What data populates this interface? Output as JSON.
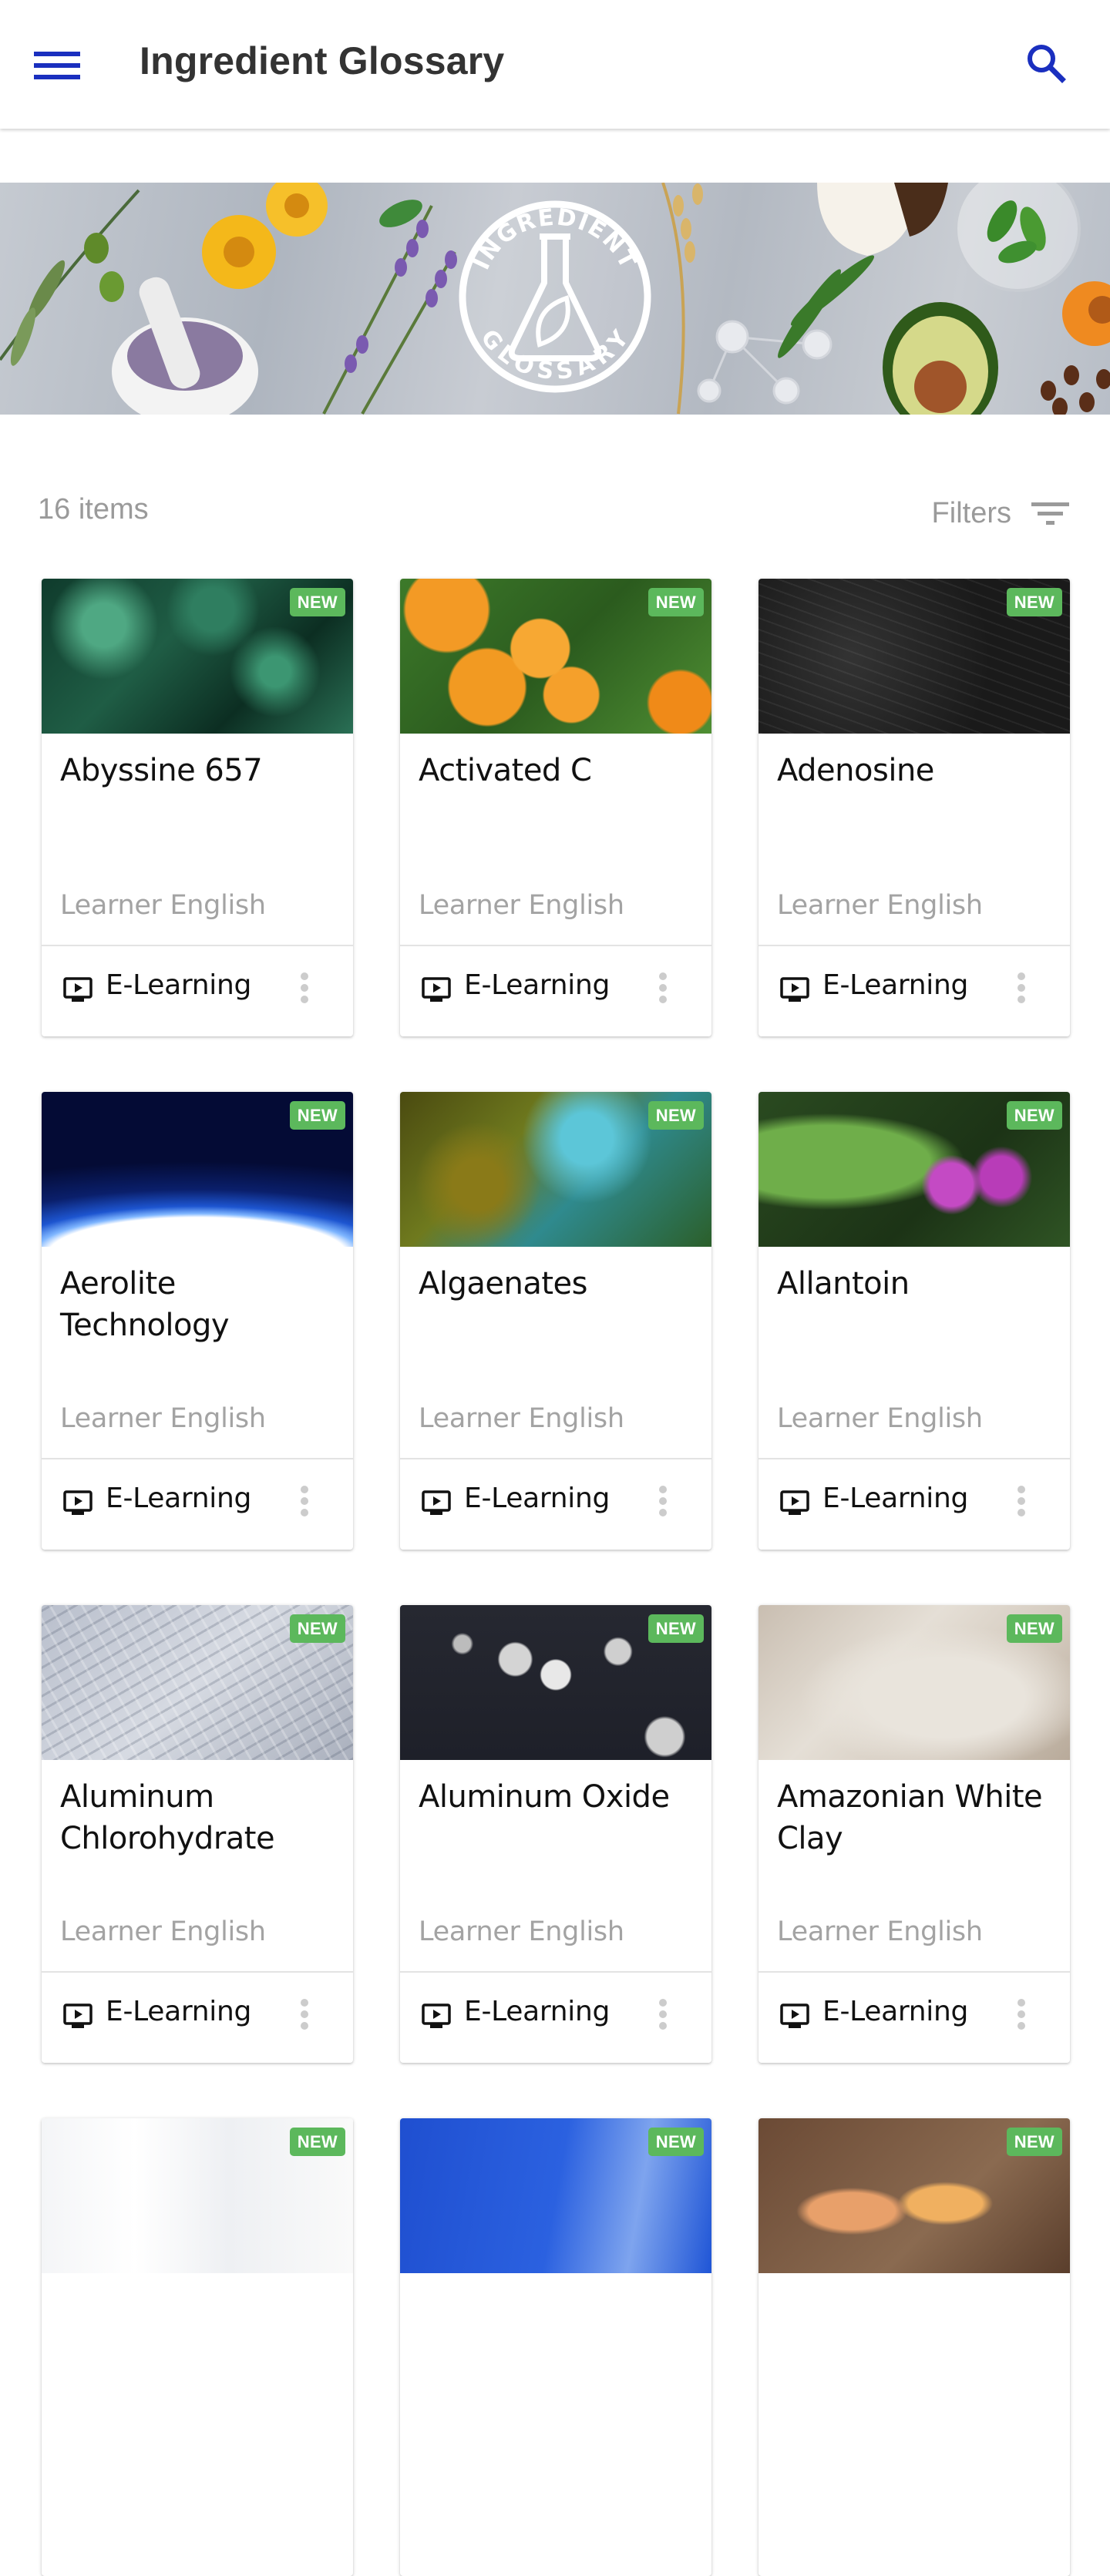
{
  "header": {
    "title": "Ingredient Glossary",
    "menu_icon": "hamburger-menu-icon",
    "search_icon": "search-icon",
    "accent_color": "#1a2fbf"
  },
  "banner": {
    "emblem_top_text": "INGREDIENT",
    "emblem_bottom_text": "GLOSSARY",
    "emblem_icon": "flask-leaf-icon"
  },
  "toolbar": {
    "items_count": "16 items",
    "filters_label": "Filters",
    "filter_icon": "filter-list-icon"
  },
  "badge_color": "#5cb85c",
  "cards": [
    {
      "title": "Abyssine 657",
      "badge": "NEW",
      "language": "Learner English",
      "type": "E-Learning",
      "type_icon": "elearning-monitor-icon"
    },
    {
      "title": "Activated C",
      "badge": "NEW",
      "language": "Learner English",
      "type": "E-Learning",
      "type_icon": "elearning-monitor-icon"
    },
    {
      "title": "Adenosine",
      "badge": "NEW",
      "language": "Learner English",
      "type": "E-Learning",
      "type_icon": "elearning-monitor-icon"
    },
    {
      "title": "Aerolite Technology",
      "badge": "NEW",
      "language": "Learner English",
      "type": "E-Learning",
      "type_icon": "elearning-monitor-icon"
    },
    {
      "title": "Algaenates",
      "badge": "NEW",
      "language": "Learner English",
      "type": "E-Learning",
      "type_icon": "elearning-monitor-icon"
    },
    {
      "title": "Allantoin",
      "badge": "NEW",
      "language": "Learner English",
      "type": "E-Learning",
      "type_icon": "elearning-monitor-icon"
    },
    {
      "title": "Aluminum Chlorohydrate",
      "badge": "NEW",
      "language": "Learner English",
      "type": "E-Learning",
      "type_icon": "elearning-monitor-icon"
    },
    {
      "title": "Aluminum Oxide",
      "badge": "NEW",
      "language": "Learner English",
      "type": "E-Learning",
      "type_icon": "elearning-monitor-icon"
    },
    {
      "title": "Amazonian White Clay",
      "badge": "NEW",
      "language": "Learner English",
      "type": "E-Learning",
      "type_icon": "elearning-monitor-icon"
    },
    {
      "title": "",
      "badge": "NEW",
      "language": "",
      "type": "",
      "type_icon": ""
    },
    {
      "title": "",
      "badge": "NEW",
      "language": "",
      "type": "",
      "type_icon": ""
    },
    {
      "title": "",
      "badge": "NEW",
      "language": "",
      "type": "",
      "type_icon": ""
    }
  ]
}
